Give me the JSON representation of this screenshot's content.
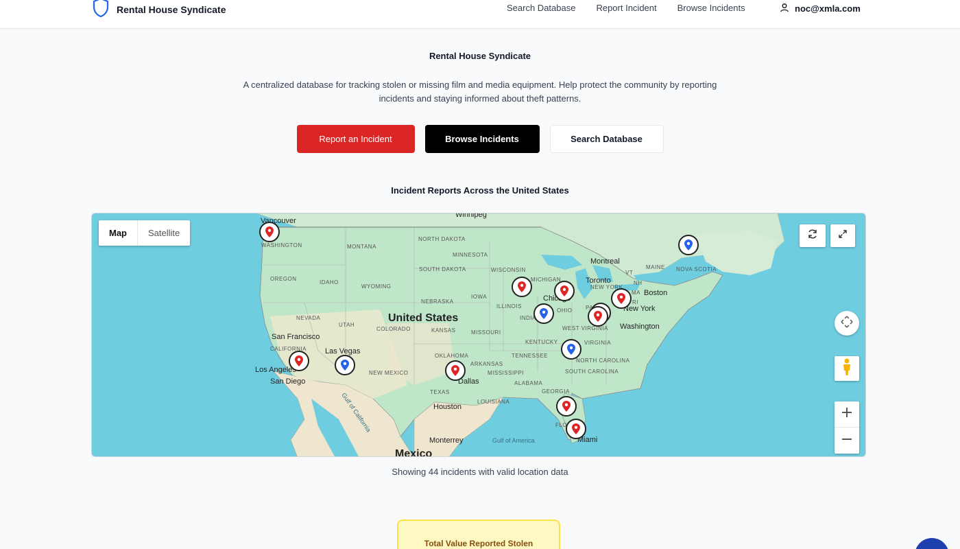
{
  "header": {
    "brand": "Rental House Syndicate",
    "nav": [
      "Search Database",
      "Report Incident",
      "Browse Incidents"
    ],
    "user_email": "noc@xmla.com"
  },
  "hero": {
    "title": "Rental House Syndicate",
    "description": "A centralized database for tracking stolen or missing film and media equipment. Help protect the community by reporting incidents and staying informed about theft patterns.",
    "buttons": {
      "report": "Report an Incident",
      "browse": "Browse Incidents",
      "search": "Search Database"
    }
  },
  "map": {
    "heading": "Incident Reports Across the United States",
    "type_map": "Map",
    "type_satellite": "Satellite",
    "country_label": "United States",
    "mexico_label": "Mexico",
    "states": [
      "WASHINGTON",
      "MONTANA",
      "NORTH DAKOTA",
      "MINNESOTA",
      "OREGON",
      "IDAHO",
      "WYOMING",
      "SOUTH DAKOTA",
      "WISCONSIN",
      "MICHIGAN",
      "NEBRASKA",
      "IOWA",
      "ILLINOIS",
      "NEVADA",
      "UTAH",
      "COLORADO",
      "KANSAS",
      "MISSOURI",
      "INDIANA",
      "OHIO",
      "CALIFORNIA",
      "KENTUCKY",
      "WEST VIRGINIA",
      "VIRGINIA",
      "OKLAHOMA",
      "ARKANSAS",
      "TENNESSEE",
      "NORTH CAROLINA",
      "NEW MEXICO",
      "MISSISSIPPI",
      "ALABAMA",
      "SOUTH CAROLINA",
      "TEXAS",
      "LOUISIANA",
      "GEORGIA",
      "FLORIDA",
      "NEW YORK",
      "MAINE",
      "VT",
      "NH",
      "MA",
      "RI",
      "PA",
      "NOVA SCOTIA"
    ],
    "cities": [
      "Vancouver",
      "Winnipeg",
      "Montreal",
      "Toronto",
      "Boston",
      "New York",
      "Chicago",
      "Washington",
      "San Francisco",
      "Las Vegas",
      "Los Angeles",
      "San Diego",
      "Dallas",
      "Houston",
      "Monterrey",
      "Miami"
    ],
    "water": [
      "Gulf of California",
      "Gulf of America"
    ],
    "colors": {
      "red_pin": "#dc2626",
      "blue_pin": "#2563eb",
      "water": "#6fcde0",
      "land": "#bfe6c8"
    }
  },
  "showing_text": "Showing 44 incidents with valid location data",
  "stat": {
    "title": "Total Value Reported Stolen"
  }
}
